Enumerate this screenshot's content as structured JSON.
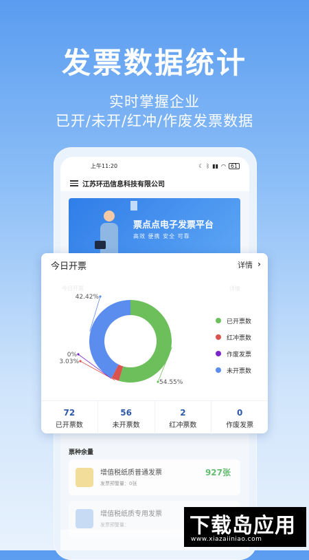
{
  "hero": {
    "title": "发票数据统计",
    "subtitle_line1": "实时掌握企业",
    "subtitle_line2": "已开/未开/红冲/作废发票数据"
  },
  "phone": {
    "status_time": "上午11:20",
    "battery": "61",
    "company_name": "江苏环迅信息科技有限公司",
    "banner_title": "票点点电子发票平台",
    "banner_tags": "高效  便携  安全  可靠",
    "section_title": "票种余量",
    "items": [
      {
        "name": "增值税纸质普通发票",
        "sub": "发票预警量：0张",
        "count": "927张",
        "color": "#f2d98a"
      },
      {
        "name": "增值税纸质专用发票",
        "sub": "发票预警量：",
        "count": "",
        "color": "#9cc4f0"
      }
    ]
  },
  "card": {
    "title": "今日开票",
    "more_label": "详情",
    "ghost_left": "今日开票",
    "ghost_right": "详情",
    "stats": [
      {
        "value": "72",
        "label": "已开票数"
      },
      {
        "value": "56",
        "label": "未开票数"
      },
      {
        "value": "2",
        "label": "红冲票数"
      },
      {
        "value": "0",
        "label": "作废发票"
      }
    ]
  },
  "chart_data": {
    "type": "pie",
    "donut": true,
    "categories": [
      "已开票数",
      "红冲票数",
      "作废发票",
      "未开票数"
    ],
    "values": [
      54.55,
      3.03,
      0,
      42.42
    ],
    "value_labels": [
      "54.55%",
      "3.03%",
      "0%",
      "42.42%"
    ],
    "colors": [
      "#6cbf5b",
      "#d9534f",
      "#7b24c9",
      "#5b8def"
    ],
    "legend_position": "right"
  },
  "watermark": {
    "big": "下载岛应用",
    "small": "www.xiazaiiniao.com"
  }
}
